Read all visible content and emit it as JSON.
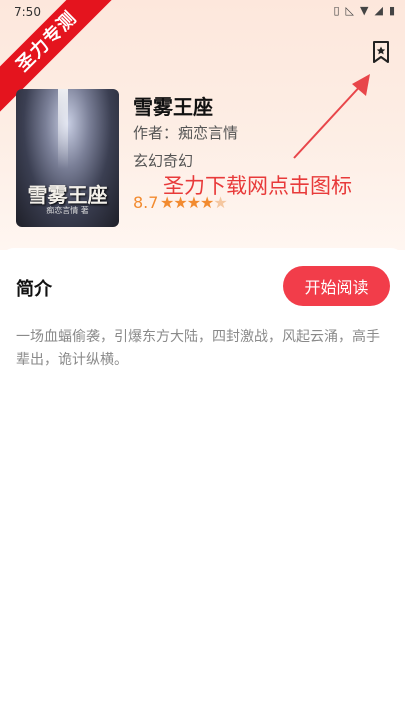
{
  "status_bar": {
    "time": "7:50"
  },
  "banner": {
    "text": "圣力专测"
  },
  "header": {
    "bookmark_icon": "bookmark-star-icon"
  },
  "book": {
    "cover_title": "雪雾王座",
    "cover_author": "痴恋言情 著",
    "title": "雪雾王座",
    "author_line": "作者：痴恋言情",
    "genre": "玄幻奇幻",
    "rating": "8.7",
    "stars": 4
  },
  "annotation": {
    "text": "圣力下载网点击图标"
  },
  "intro": {
    "title": "简介",
    "start_button": "开始阅读",
    "summary": "一场血蝠偷袭，引爆东方大陆，四封激战，风起云涌，高手辈出，诡计纵横。"
  },
  "colors": {
    "accent": "#f23d4a",
    "rating": "#f28b30",
    "banner": "#e4141e"
  }
}
